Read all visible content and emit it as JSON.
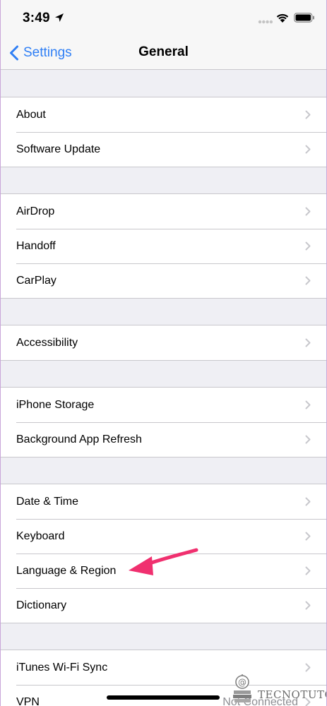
{
  "status_bar": {
    "time": "3:49"
  },
  "nav": {
    "back_label": "Settings",
    "title": "General"
  },
  "groups": [
    {
      "items": [
        {
          "label": "About"
        },
        {
          "label": "Software Update"
        }
      ]
    },
    {
      "items": [
        {
          "label": "AirDrop"
        },
        {
          "label": "Handoff"
        },
        {
          "label": "CarPlay"
        }
      ]
    },
    {
      "items": [
        {
          "label": "Accessibility"
        }
      ]
    },
    {
      "items": [
        {
          "label": "iPhone Storage"
        },
        {
          "label": "Background App Refresh"
        }
      ]
    },
    {
      "items": [
        {
          "label": "Date & Time"
        },
        {
          "label": "Keyboard"
        },
        {
          "label": "Language & Region"
        },
        {
          "label": "Dictionary"
        }
      ]
    },
    {
      "items": [
        {
          "label": "iTunes Wi-Fi Sync"
        },
        {
          "label": "VPN",
          "value": "Not Connected"
        }
      ]
    }
  ],
  "annotation": {
    "arrow_color": "#f0306f",
    "target": "Language & Region"
  },
  "watermark": {
    "text": "TECNOTUTO"
  },
  "colors": {
    "accent": "#2f7ff5",
    "background": "#efeff4",
    "separator": "#c8c7cc"
  }
}
